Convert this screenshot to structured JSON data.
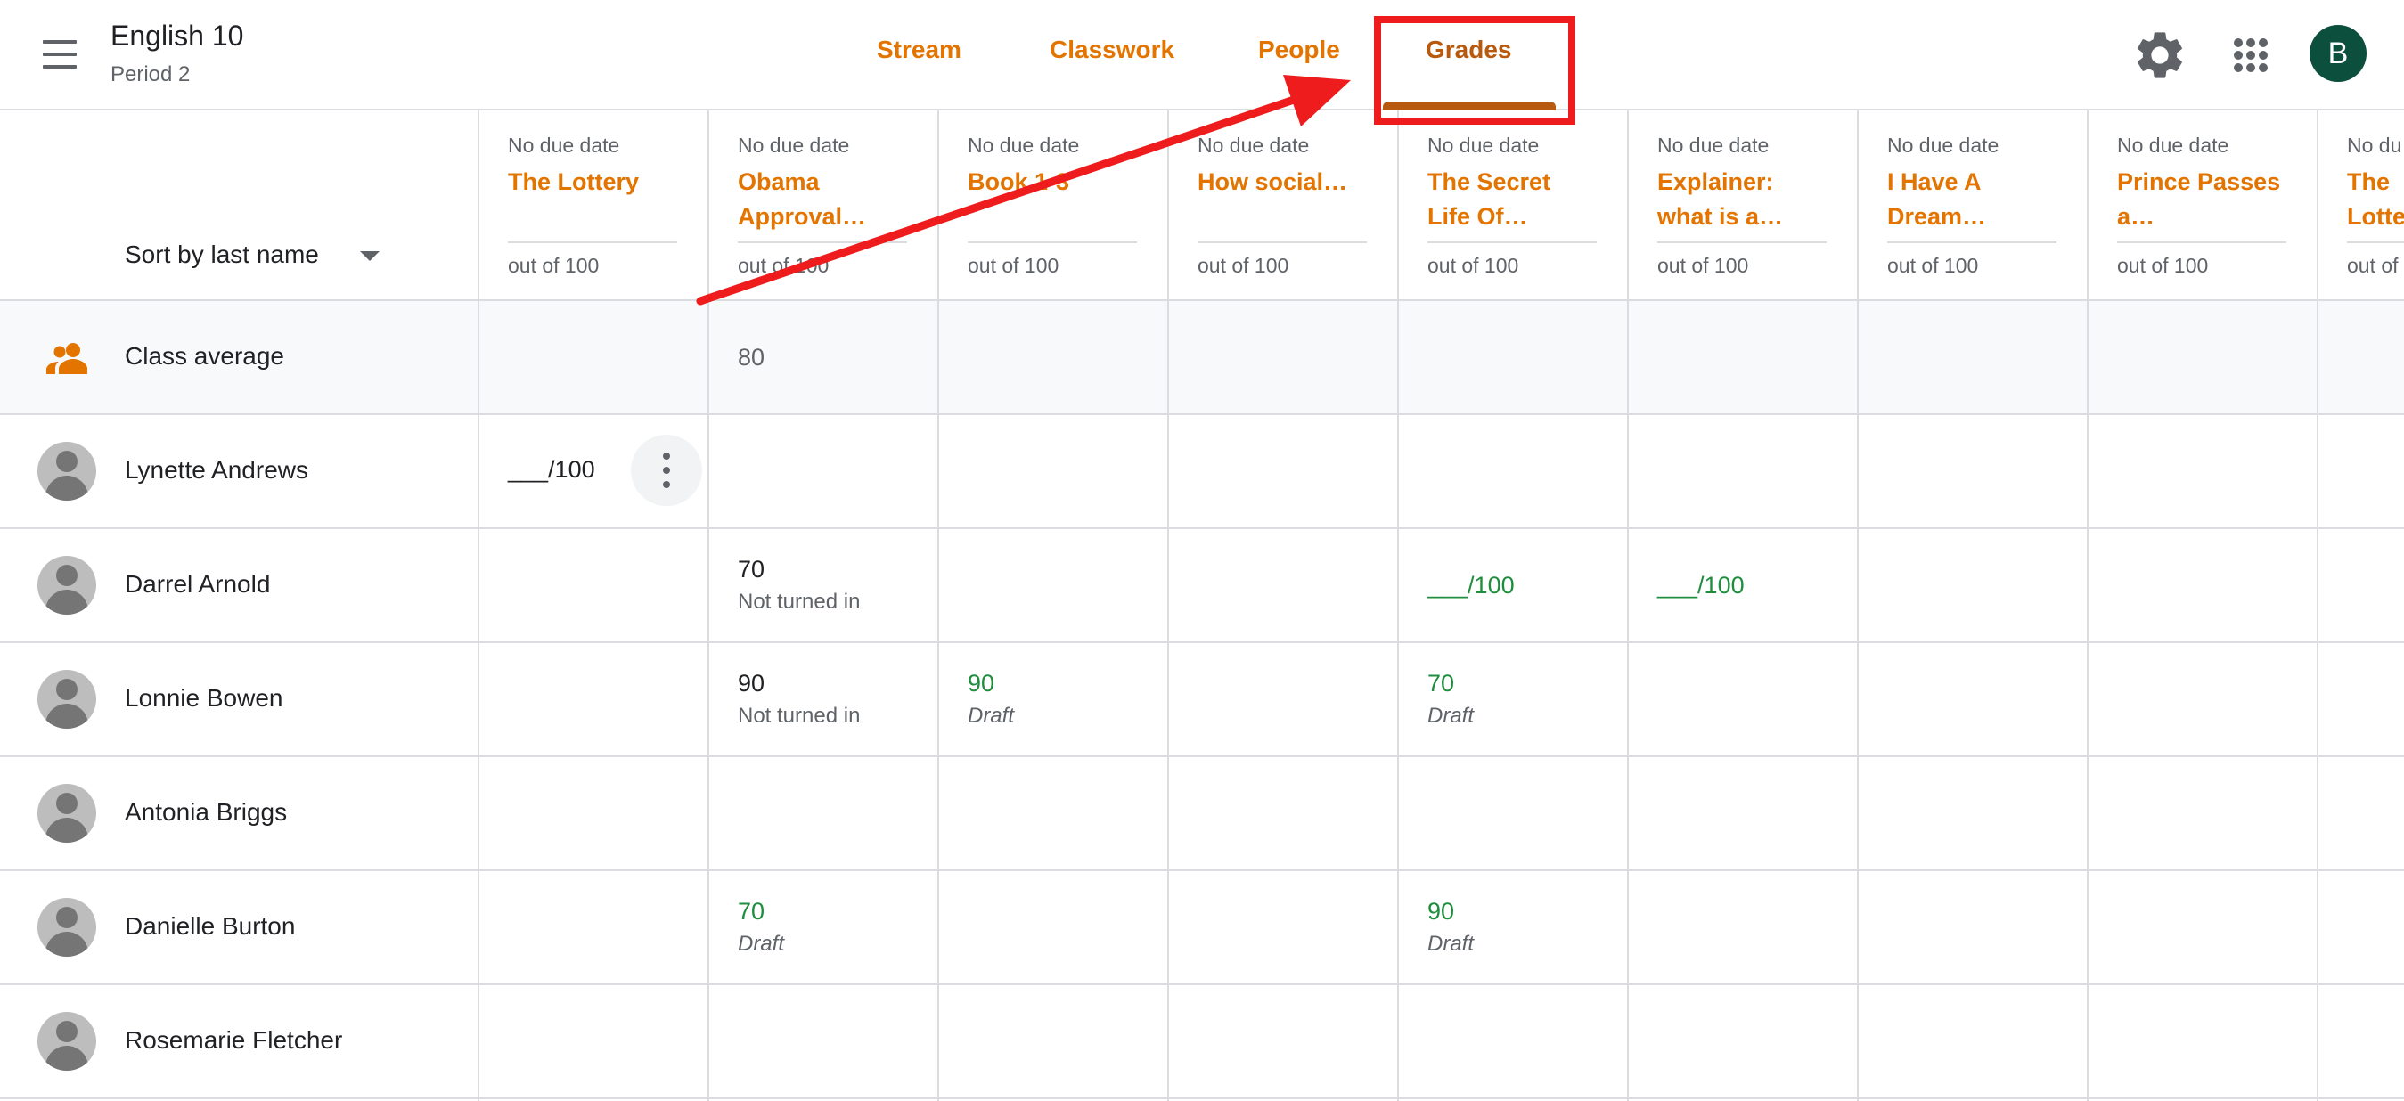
{
  "header": {
    "class_name": "English 10",
    "class_section": "Period 2",
    "tabs": [
      {
        "label": "Stream"
      },
      {
        "label": "Classwork"
      },
      {
        "label": "People"
      },
      {
        "label": "Grades",
        "active": true
      }
    ],
    "avatar_letter": "B",
    "icons": [
      "menu-icon",
      "gear-icon",
      "apps-grid-icon"
    ]
  },
  "colors": {
    "accent": "#e37400",
    "active_tab": "#b75a0f",
    "draft_green": "#1e8e3e",
    "annotation_red": "#ee1c1c",
    "avatar_bg": "#0b4f3c"
  },
  "gradebook": {
    "sort_label": "Sort by last name",
    "class_average_label": "Class average",
    "columns": [
      {
        "due": "No due date",
        "title": "The Lottery",
        "out_of": "out of 100"
      },
      {
        "due": "No due date",
        "title": "Obama Approval…",
        "out_of": "out of 100"
      },
      {
        "due": "No due date",
        "title": "Book 1-3",
        "out_of": "out of 100"
      },
      {
        "due": "No due date",
        "title": "How social…",
        "out_of": "out of 100"
      },
      {
        "due": "No due date",
        "title": "The Secret Life Of…",
        "out_of": "out of 100"
      },
      {
        "due": "No due date",
        "title": "Explainer: what is a…",
        "out_of": "out of 100"
      },
      {
        "due": "No due date",
        "title": "I Have A Dream…",
        "out_of": "out of 100"
      },
      {
        "due": "No due date",
        "title": "Prince Passes a…",
        "out_of": "out of 100"
      },
      {
        "due": "No du",
        "title": "The Lotte",
        "out_of": "out of"
      }
    ],
    "class_average": {
      "obama": "80"
    },
    "students": [
      {
        "name": "Lynette Andrews",
        "lottery": "___/100"
      },
      {
        "name": "Darrel Arnold",
        "obama": "70",
        "obama_status": "Not turned in",
        "secret_life": "___/100",
        "explainer": "___/100"
      },
      {
        "name": "Lonnie Bowen",
        "obama": "90",
        "obama_status": "Not turned in",
        "book": "90",
        "book_status": "Draft",
        "secret_life": "70",
        "secret_life_status": "Draft"
      },
      {
        "name": "Antonia Briggs"
      },
      {
        "name": "Danielle Burton",
        "obama": "70",
        "obama_status": "Draft",
        "secret_life": "90",
        "secret_life_status": "Draft"
      },
      {
        "name": "Rosemarie Fletcher"
      }
    ]
  }
}
